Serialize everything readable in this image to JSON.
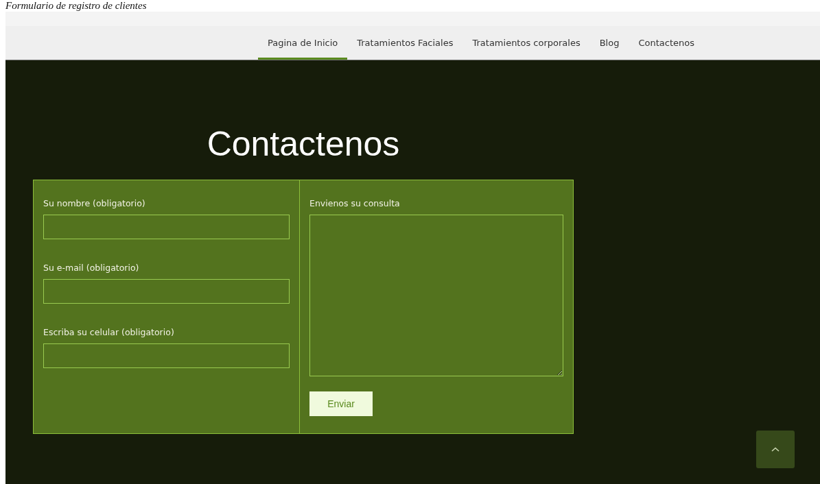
{
  "caption": "Formulario de registro de clientes",
  "nav": [
    {
      "label": "Pagina de Inicio",
      "selected": true
    },
    {
      "label": "Tratamientos Faciales",
      "selected": false
    },
    {
      "label": "Tratamientos corporales",
      "selected": false
    },
    {
      "label": "Blog",
      "selected": false
    },
    {
      "label": "Contactenos",
      "selected": false
    }
  ],
  "heading": "Contactenos",
  "form": {
    "fields": [
      {
        "label": "Su nombre (obligatorio)"
      },
      {
        "label": "Su e-mail (obligatorio)"
      },
      {
        "label": "Escriba su celular (obligatorio)"
      }
    ],
    "message": {
      "label": "Envienos su consulta"
    },
    "submit": "Enviar"
  }
}
